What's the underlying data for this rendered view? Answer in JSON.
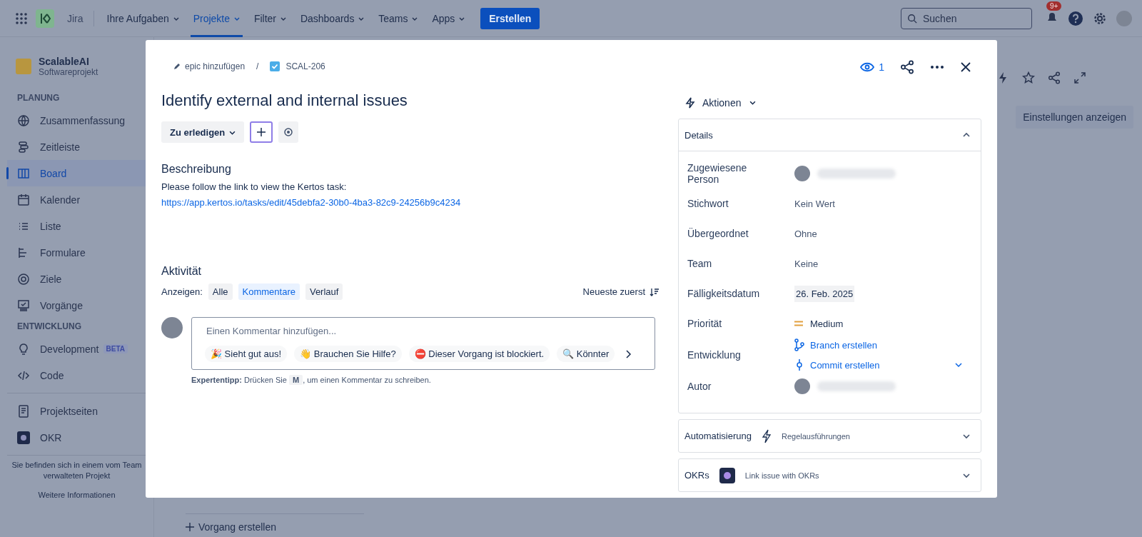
{
  "topnav": {
    "product": "Jira",
    "items": [
      {
        "label": "Ihre Aufgaben",
        "selected": false
      },
      {
        "label": "Projekte",
        "selected": true
      },
      {
        "label": "Filter",
        "selected": false
      },
      {
        "label": "Dashboards",
        "selected": false
      },
      {
        "label": "Teams",
        "selected": false
      },
      {
        "label": "Apps",
        "selected": false
      }
    ],
    "create": "Erstellen",
    "search": {
      "placeholder": "Suchen"
    },
    "notifications": "9+"
  },
  "sidebar": {
    "project": {
      "name": "ScalableAI",
      "type": "Softwareprojekt"
    },
    "sections": [
      {
        "title": "PLANUNG",
        "items": [
          {
            "label": "Zusammenfassung",
            "selected": false
          },
          {
            "label": "Zeitleiste",
            "selected": false
          },
          {
            "label": "Board",
            "selected": true
          },
          {
            "label": "Kalender",
            "selected": false
          },
          {
            "label": "Liste",
            "selected": false
          },
          {
            "label": "Formulare",
            "selected": false
          },
          {
            "label": "Ziele",
            "selected": false
          },
          {
            "label": "Vorgänge",
            "selected": false
          }
        ]
      },
      {
        "title": "ENTWICKLUNG",
        "items": [
          {
            "label": "Development",
            "selected": false,
            "badge": "BETA"
          },
          {
            "label": "Code",
            "selected": false
          }
        ]
      }
    ],
    "bottom_items": [
      {
        "label": "Projektseiten"
      },
      {
        "label": "OKR"
      }
    ],
    "footer": {
      "text": "Sie befinden sich in einem vom Team verwalteten Projekt",
      "link": "Weitere Informationen"
    }
  },
  "board": {
    "settings_button": "Einstellungen anzeigen",
    "create_issue": "Vorgang erstellen"
  },
  "modal": {
    "breadcrumb": {
      "epic": "epic hinzufügen",
      "separator": "/",
      "key": "SCAL-206"
    },
    "watchers": "1",
    "title": "Identify external and internal issues",
    "status": "Zu erledigen",
    "description": {
      "heading": "Beschreibung",
      "text": "Please follow the link to view the Kertos task:",
      "link": "https://app.kertos.io/tasks/edit/45debfa2-30b0-4ba3-82c9-24256b9c4234"
    },
    "activity": {
      "heading": "Aktivität",
      "filter_label": "Anzeigen:",
      "filters": [
        {
          "label": "Alle",
          "selected": false
        },
        {
          "label": "Kommentare",
          "selected": true
        },
        {
          "label": "Verlauf",
          "selected": false
        }
      ],
      "sort": "Neueste zuerst",
      "comment_placeholder": "Einen Kommentar hinzufügen...",
      "quick_replies": [
        {
          "emoji": "🎉",
          "label": "Sieht gut aus!"
        },
        {
          "emoji": "👋",
          "label": "Brauchen Sie Hilfe?"
        },
        {
          "emoji": "⛔",
          "label": "Dieser Vorgang ist blockiert."
        },
        {
          "emoji": "🔍",
          "label": "Könnter"
        }
      ],
      "tip": {
        "before": "**Expertentipp:** Drücken Sie",
        "key": "M",
        "after": ", um einen Kommentar zu schreiben."
      }
    },
    "actions": "Aktionen",
    "details": {
      "title": "Details",
      "expanded": true,
      "fields": [
        {
          "kind": "person",
          "label": "Zugewiesene Person"
        },
        {
          "kind": "text",
          "label": "Stichwort",
          "value": "Kein Wert"
        },
        {
          "kind": "text",
          "label": "Übergeordnet",
          "value": "Ohne"
        },
        {
          "kind": "text",
          "label": "Team",
          "value": "Keine"
        },
        {
          "kind": "date",
          "label": "Fälligkeitsdatum",
          "value": "26. Feb. 2025"
        },
        {
          "kind": "priority",
          "label": "Priorität",
          "value": "Medium"
        },
        {
          "kind": "links",
          "label": "Entwicklung",
          "links": [
            "Branch erstellen",
            "Commit erstellen"
          ]
        },
        {
          "kind": "person",
          "label": "Autor"
        }
      ]
    },
    "panels": [
      {
        "kind": "automation",
        "title": "Automatisierung",
        "subtitle": "Regelausführungen",
        "expanded": false
      },
      {
        "kind": "okr",
        "title": "OKRs",
        "subtitle": "Link issue with OKRs",
        "expanded": false
      }
    ]
  }
}
